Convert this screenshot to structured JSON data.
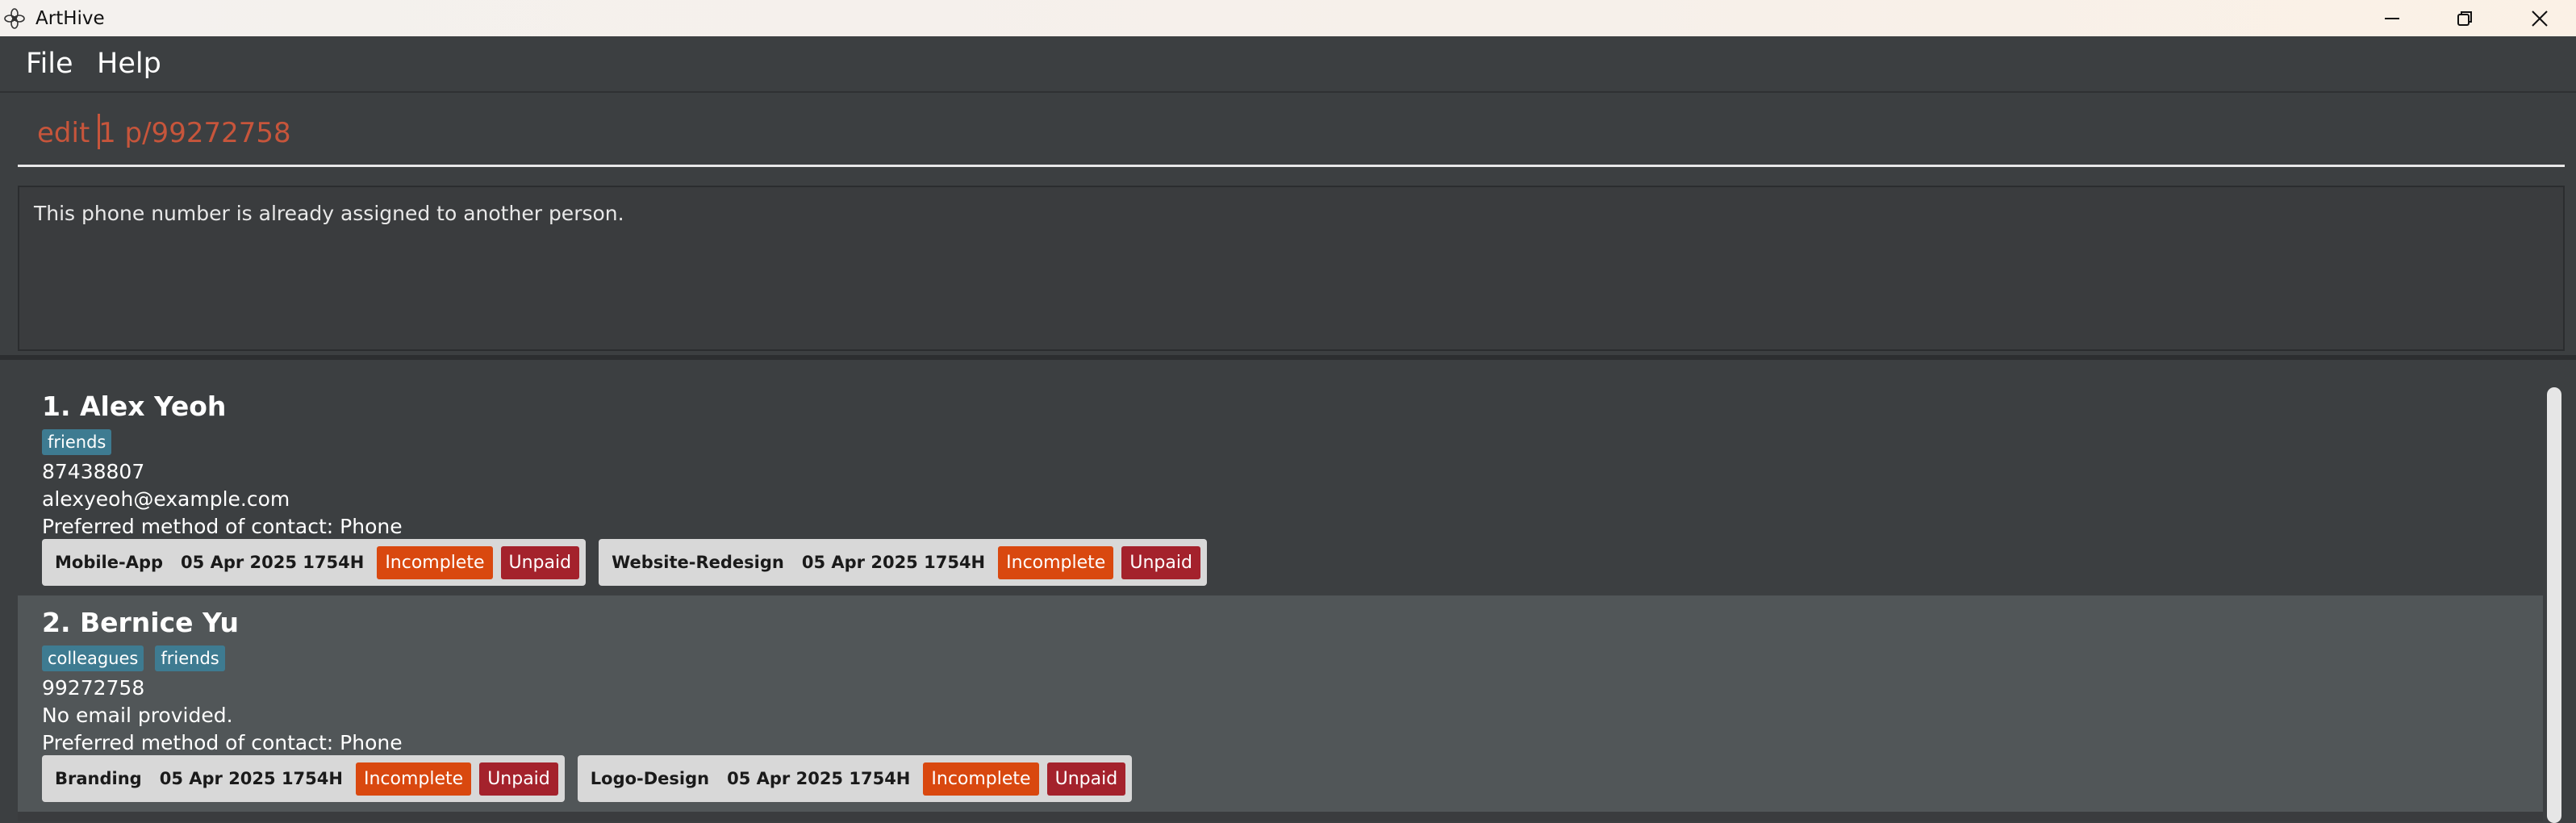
{
  "window": {
    "title": "ArtHive",
    "icon": "flower-logo-icon",
    "controls": [
      "minimize-icon",
      "restore-icon",
      "close-icon"
    ]
  },
  "menu": {
    "file": "File",
    "help": "Help"
  },
  "command": {
    "value": "edit 1 p/99272758"
  },
  "result": {
    "message": "This phone number is already assigned to another person."
  },
  "persons": [
    {
      "name": "1. Alex Yeoh",
      "tags": [
        "friends"
      ],
      "phone": "87438807",
      "email": "alexyeoh@example.com",
      "preferred": "Preferred method of contact: Phone",
      "projects": [
        {
          "name": "Mobile-App",
          "date": "05 Apr 2025 1754H",
          "status": "Incomplete",
          "payment": "Unpaid"
        },
        {
          "name": "Website-Redesign",
          "date": "05 Apr 2025 1754H",
          "status": "Incomplete",
          "payment": "Unpaid"
        }
      ]
    },
    {
      "name": "2. Bernice Yu",
      "tags": [
        "colleagues",
        "friends"
      ],
      "phone": "99272758",
      "email": "No email provided.",
      "preferred": "Preferred method of contact: Phone",
      "projects": [
        {
          "name": "Branding",
          "date": "05 Apr 2025 1754H",
          "status": "Incomplete",
          "payment": "Unpaid"
        },
        {
          "name": "Logo-Design",
          "date": "05 Apr 2025 1754H",
          "status": "Incomplete",
          "payment": "Unpaid"
        }
      ]
    }
  ],
  "colors": {
    "background": "#3c3f41",
    "selected_card": "#515658",
    "tag": "#3e7b91",
    "command_text": "#c7553b",
    "incomplete": "#d9480f",
    "unpaid": "#a4222c"
  }
}
